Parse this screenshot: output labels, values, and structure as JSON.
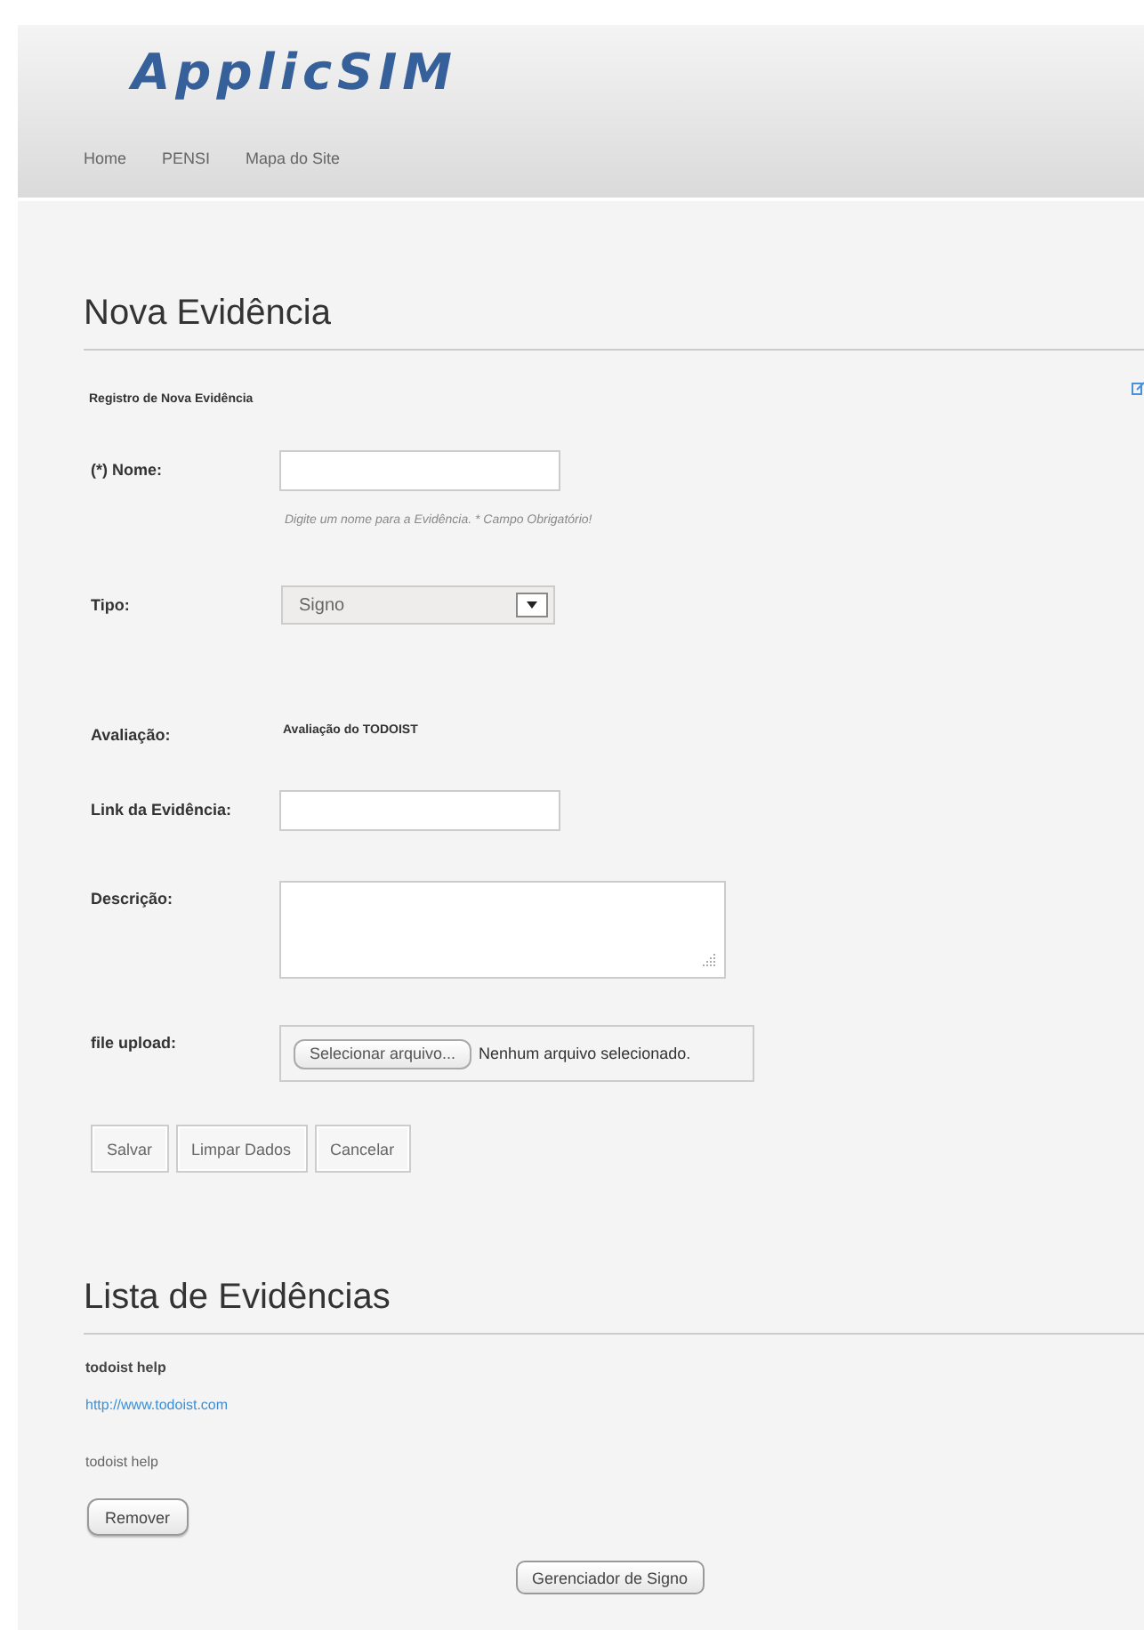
{
  "header": {
    "logo": "ApplicSIM",
    "nav": [
      "Home",
      "PENSI",
      "Mapa do Site"
    ]
  },
  "form": {
    "title": "Nova Evidência",
    "subtitle": "Registro de Nova Evidência",
    "fields": [
      {
        "kind": "input",
        "label": "(*) Nome:",
        "hint": "Digite um nome para a Evidência. * Campo Obrigatório!"
      },
      {
        "kind": "select",
        "label": "Tipo:",
        "value": "Signo"
      },
      {
        "kind": "text",
        "label": "Avaliação:",
        "value": "Avaliação do TODOIST"
      },
      {
        "kind": "input",
        "label": "Link da Evidência:"
      },
      {
        "kind": "textarea",
        "label": "Descrição:"
      },
      {
        "kind": "file",
        "label": "file upload:",
        "button": "Selecionar arquivo...",
        "status": "Nenhum arquivo selecionado."
      }
    ],
    "buttons": [
      "Salvar",
      "Limpar Dados",
      "Cancelar"
    ]
  },
  "list": {
    "title": "Lista de Evidências",
    "items": [
      {
        "name": "todoist help",
        "link": "http://www.todoist.com",
        "description": "todoist help",
        "button": "Remover"
      }
    ],
    "footer_button": "Gerenciador de Signo"
  }
}
